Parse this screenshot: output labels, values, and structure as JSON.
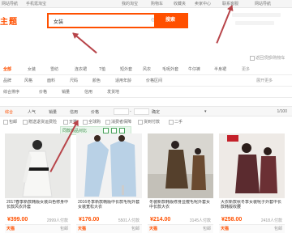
{
  "top_nav": {
    "left": [
      "网站导航",
      "手机逛淘宝"
    ],
    "right": [
      "我的淘宝",
      "购物车",
      "收藏夹",
      "卖家中心",
      "联系客服",
      "网站导航"
    ]
  },
  "brand": "主题",
  "search": {
    "query": "女装",
    "button": "搜索"
  },
  "cart_note": "返回顶部/购物车",
  "category_row": [
    "全部",
    "女装",
    "雪纺",
    "连衣裙",
    "T恤",
    "短外套",
    "风衣",
    "毛呢外套",
    "牛仔裤",
    "半身裙",
    "更多"
  ],
  "attr_row": [
    "品牌",
    "风格",
    "面料",
    "尺码",
    "颜色",
    "适用年龄",
    "价格区间"
  ],
  "attr_right": "展开更多",
  "filter_row": [
    "综合排序",
    "价格",
    "销量",
    "信用",
    "发货地"
  ],
  "sort_bar": {
    "items": [
      "综合",
      "人气",
      "销量",
      "信用",
      "价格"
    ],
    "range_sep": "-",
    "confirm": "确定",
    "pager": "1/100"
  },
  "options": [
    "包邮",
    "赠送退货运费险",
    "天猫",
    "全球购",
    "消费者保障",
    "货到付款",
    "二手"
  ],
  "grid_tool": "同款商品对比",
  "products": [
    {
      "title": "2017春季新款韩版女装白色修身中长款风衣外套",
      "price": "¥399.00",
      "sold": "2999人付款",
      "tag": "天猫",
      "meta": "包邮"
    },
    {
      "title": "2016冬季新款韩版中长款毛呢外套女装宽松大衣",
      "price": "¥176.00",
      "sold": "5501人付款",
      "tag": "天猫",
      "meta": "包邮"
    },
    {
      "title": "冬装新款韩版修身显瘦毛呢外套女中长款大衣",
      "price": "¥214.00",
      "sold": "3145人付款",
      "tag": "天猫",
      "meta": "包邮"
    },
    {
      "title": "大衣新款秋冬季女装呢子外套中长款韩版收腰",
      "price": "¥258.00",
      "sold": "2418人付款",
      "tag": "天猫",
      "meta": "包邮"
    }
  ],
  "colors": {
    "accent": "#ff5000",
    "arrow": "#b8454a"
  }
}
